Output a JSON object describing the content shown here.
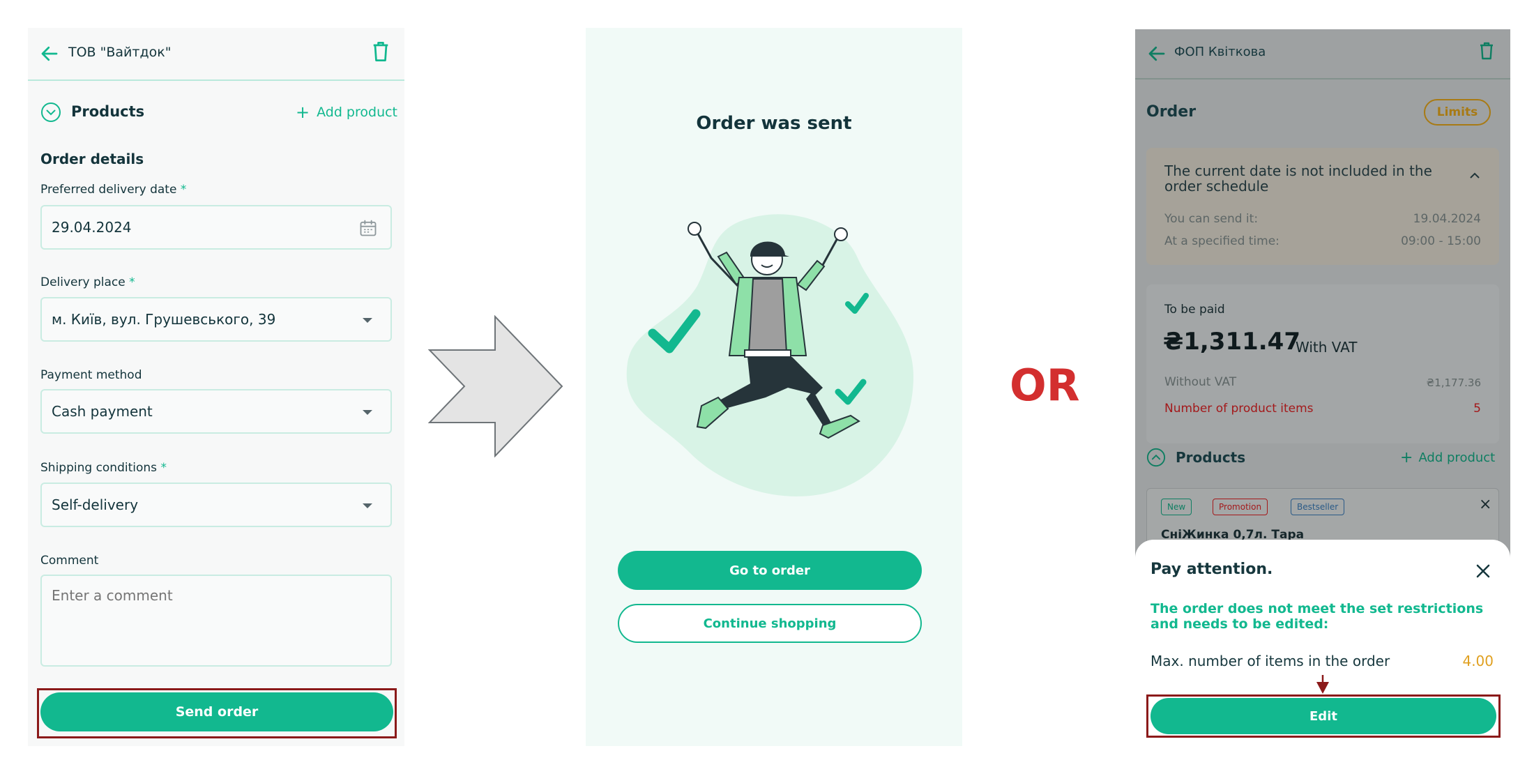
{
  "panel1": {
    "company": "ТОВ \"Вайтдок\"",
    "products_label": "Products",
    "add_product": "Add product",
    "order_details_title": "Order details",
    "delivery_date": {
      "label": "Preferred delivery date",
      "required": "*",
      "value": "29.04.2024"
    },
    "delivery_place": {
      "label": "Delivery place",
      "required": "*",
      "value": "м. Київ, вул. Грушевського, 39"
    },
    "payment_method": {
      "label": "Payment method",
      "value": "Cash payment"
    },
    "shipping": {
      "label": "Shipping conditions",
      "required": "*",
      "value": "Self-delivery"
    },
    "comment": {
      "label": "Comment",
      "placeholder": "Enter a comment"
    },
    "send_order": "Send order"
  },
  "panel2": {
    "title": "Order was sent",
    "go_to_order": "Go to order",
    "continue_shopping": "Continue shopping"
  },
  "or_label": "OR",
  "panel3": {
    "company": "ФОП Квіткова",
    "order_title": "Order",
    "limits": "Limits",
    "notice": {
      "title": "The current date is not included in the order schedule",
      "send_label": "You can send it:",
      "send_value": "19.04.2024",
      "time_label": "At a specified time:",
      "time_value": "09:00 - 15:00"
    },
    "payment": {
      "to_be_paid": "To be paid",
      "amount": "₴1,311.47",
      "with_vat": "With VAT",
      "without_vat_label": "Without VAT",
      "without_vat_value": "₴1,177.36",
      "items_label": "Number of product items",
      "items_value": "5"
    },
    "products_label": "Products",
    "add_product": "Add product",
    "product": {
      "badges": [
        "New",
        "Promotion",
        "Bestseller"
      ],
      "name": "СніЖинка 0,7л. Тара"
    },
    "sheet": {
      "title": "Pay attention.",
      "message": "The order does not meet the set restrictions and needs to be edited:",
      "restriction_label": "Max. number of items in the order",
      "restriction_value": "4.00",
      "edit": "Edit"
    }
  },
  "colors": {
    "accent": "#12b88f",
    "dark_text": "#13343b",
    "highlight": "#8b1a1a",
    "or_red": "#d32f2f",
    "warning": "#e0a020"
  }
}
